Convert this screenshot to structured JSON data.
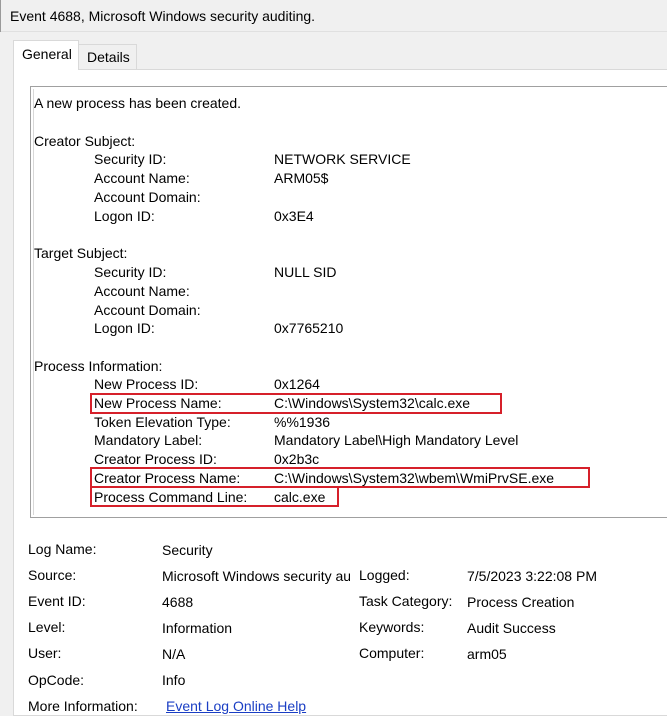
{
  "window": {
    "title": "Event 4688, Microsoft Windows security auditing."
  },
  "tabs": [
    {
      "label": "General",
      "selected": true
    },
    {
      "label": "Details",
      "selected": false
    }
  ],
  "description": {
    "intro": "A new process has been created.",
    "creator_subject": {
      "heading": "Creator Subject:",
      "fields": [
        {
          "label": "Security ID:",
          "value": "NETWORK SERVICE"
        },
        {
          "label": "Account Name:",
          "value": "ARM05$"
        },
        {
          "label": "Account Domain:",
          "value": ""
        },
        {
          "label": "Logon ID:",
          "value": "0x3E4"
        }
      ]
    },
    "target_subject": {
      "heading": "Target Subject:",
      "fields": [
        {
          "label": "Security ID:",
          "value": "NULL SID"
        },
        {
          "label": "Account Name:",
          "value": ""
        },
        {
          "label": "Account Domain:",
          "value": ""
        },
        {
          "label": "Logon ID:",
          "value": "0x7765210"
        }
      ]
    },
    "process_information": {
      "heading": "Process Information:",
      "fields": [
        {
          "label": "New Process ID:",
          "value": "0x1264",
          "highlighted": false
        },
        {
          "label": "New Process Name:",
          "value": "C:\\Windows\\System32\\calc.exe",
          "highlighted": true
        },
        {
          "label": "Token Elevation Type:",
          "value": "%%1936",
          "highlighted": false
        },
        {
          "label": "Mandatory Label:",
          "value": "Mandatory Label\\High Mandatory Level",
          "highlighted": false
        },
        {
          "label": "Creator Process ID:",
          "value": "0x2b3c",
          "highlighted": false
        },
        {
          "label": "Creator Process Name:",
          "value": "C:\\Windows\\System32\\wbem\\WmiPrvSE.exe",
          "highlighted": true
        },
        {
          "label": "Process Command Line:",
          "value": "calc.exe",
          "highlighted": true
        }
      ]
    }
  },
  "metadata": {
    "log_name": {
      "label": "Log Name:",
      "value": "Security"
    },
    "source": {
      "label": "Source:",
      "value": "Microsoft Windows security auditing."
    },
    "logged": {
      "label": "Logged:",
      "value": "7/5/2023 3:22:08 PM"
    },
    "event_id": {
      "label": "Event ID:",
      "value": "4688"
    },
    "task_category": {
      "label": "Task Category:",
      "value": "Process Creation"
    },
    "level": {
      "label": "Level:",
      "value": "Information"
    },
    "keywords": {
      "label": "Keywords:",
      "value": "Audit Success"
    },
    "user": {
      "label": "User:",
      "value": "N/A"
    },
    "computer": {
      "label": "Computer:",
      "value": "arm05"
    },
    "opcode": {
      "label": "OpCode:",
      "value": "Info"
    },
    "more_information": {
      "label": "More Information:",
      "link_text": "Event Log Online Help"
    }
  },
  "colors": {
    "highlight_border": "#d6202a",
    "link": "#1a3ec4",
    "window_background": "#f0f0f0"
  }
}
